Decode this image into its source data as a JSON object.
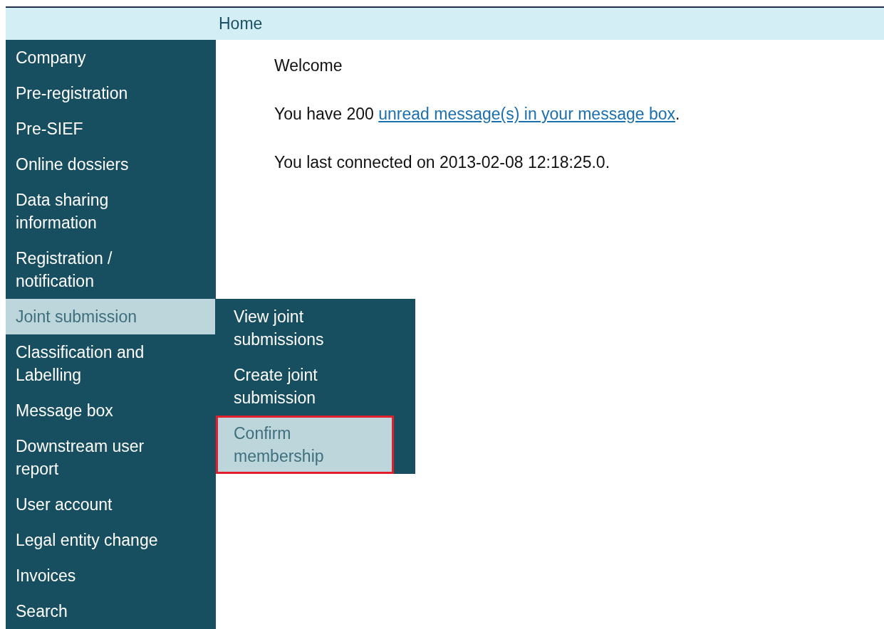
{
  "header": {
    "title": "Home"
  },
  "sidebar": {
    "items": [
      {
        "label": "Company",
        "selected": false
      },
      {
        "label": "Pre-registration",
        "selected": false
      },
      {
        "label": "Pre-SIEF",
        "selected": false
      },
      {
        "label": "Online dossiers",
        "selected": false
      },
      {
        "label": "Data sharing information",
        "selected": false
      },
      {
        "label": "Registration / notification",
        "selected": false
      },
      {
        "label": "Joint submission",
        "selected": true,
        "children": [
          {
            "label": "View joint submissions",
            "selected": false,
            "outlined": false
          },
          {
            "label": "Create joint submission",
            "selected": false,
            "outlined": false
          },
          {
            "label": "Confirm membership",
            "selected": true,
            "outlined": true
          }
        ]
      },
      {
        "label": "Classification and Labelling",
        "selected": false
      },
      {
        "label": "Message box",
        "selected": false
      },
      {
        "label": "Downstream user report",
        "selected": false
      },
      {
        "label": "User account",
        "selected": false
      },
      {
        "label": "Legal entity change",
        "selected": false
      },
      {
        "label": "Invoices",
        "selected": false
      },
      {
        "label": "Search",
        "selected": false
      }
    ]
  },
  "content": {
    "welcome": "Welcome",
    "message_prefix": "You have 200",
    "message_link": "unread message(s) in your message box",
    "message_suffix": ".",
    "last_connected": "You last connected on 2013-02-08 12:18:25.0."
  }
}
